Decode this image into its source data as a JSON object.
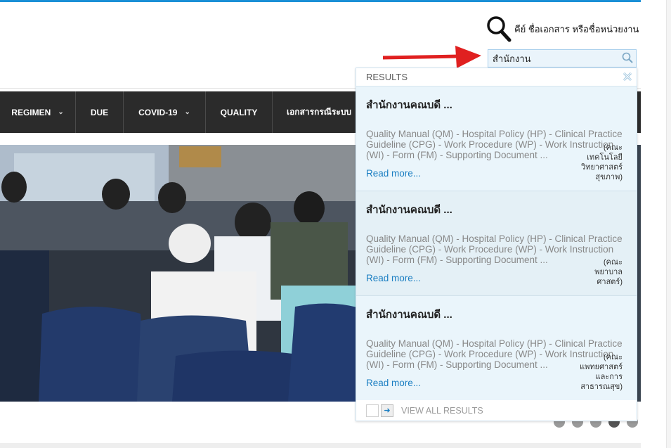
{
  "search": {
    "hint": "คีย์ ชื่อเอกสาร หรือชื่อหน่วยงาน",
    "value": "สำนักงาน"
  },
  "nav": {
    "items": [
      {
        "label": "REGIMEN",
        "caret": true
      },
      {
        "label": "DUE",
        "caret": false
      },
      {
        "label": "COVID-19",
        "caret": true
      },
      {
        "label": "QUALITY",
        "caret": false
      },
      {
        "label": "เอกสารกรณีระบบ",
        "caret": false
      }
    ]
  },
  "results": {
    "header": "RESULTS",
    "items": [
      {
        "title": "สำนักงานคณบดี ...",
        "description": "Quality Manual (QM) - Hospital Policy (HP) - Clinical Practice Guideline (CPG) - Work Procedure (WP) - Work Instruction (WI) - Form (FM) - Supporting Document ...",
        "department": [
          "(คณะ",
          "เทคโนโลยี",
          "วิทยาศาสตร์",
          "สุขภาพ)"
        ],
        "read_more": "Read more..."
      },
      {
        "title": "สำนักงานคณบดี ...",
        "description": "Quality Manual (QM) - Hospital Policy (HP) - Clinical Practice Guideline (CPG) - Work Procedure (WP) - Work Instruction (WI) - Form (FM) - Supporting Document ...",
        "department": [
          "(คณะ",
          "พยาบาล",
          "ศาสตร์)"
        ],
        "read_more": "Read more..."
      },
      {
        "title": "สำนักงานคณบดี ...",
        "description": "Quality Manual (QM) - Hospital Policy (HP) - Clinical Practice Guideline (CPG) - Work Procedure (WP) - Work Instruction (WI) - Form (FM) - Supporting Document ...",
        "department": [
          "(คณะ",
          "แพทยศาสตร์",
          "และการ",
          "สาธารณสุข)"
        ],
        "read_more": "Read more..."
      }
    ],
    "view_all": "VIEW ALL RESULTS"
  },
  "carousel": {
    "slide_count": 5,
    "active_index": 3
  },
  "colors": {
    "accent": "#1a8fd6",
    "nav_bg": "#2b2b2b",
    "link": "#1a7ec2",
    "annotation_arrow": "#e02020"
  },
  "icons": [
    "magnifier-icon",
    "search-input-icon",
    "close-icon",
    "arrow-right-icon",
    "chevron-down-icon"
  ]
}
